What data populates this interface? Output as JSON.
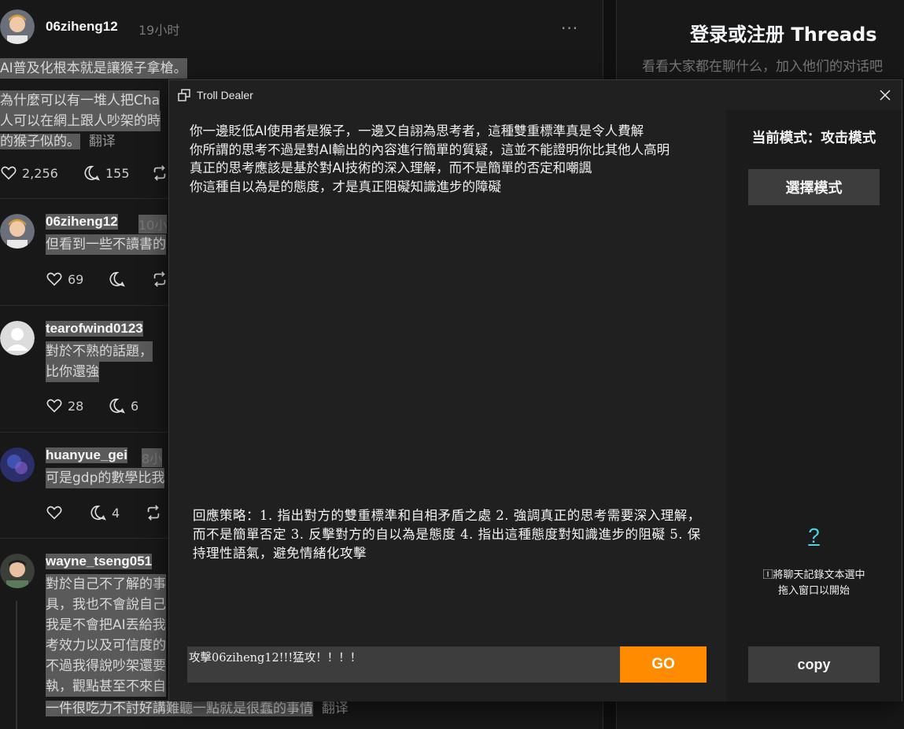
{
  "feed": {
    "posts": [
      {
        "user": "06ziheng12",
        "time": "19小时",
        "lines": [
          "AI普及化根本就是讓猴子拿槍。",
          "為什麼可以有一堆人把Cha",
          "人可以在網上跟人吵架的時",
          "的猴子似的。"
        ],
        "translate": "翻译",
        "likes": "2,256",
        "replies": "155"
      },
      {
        "user": "06ziheng12",
        "time": "10小",
        "lines": [
          "但看到一些不讀書的"
        ],
        "likes": "69"
      },
      {
        "user": "tearofwind0123",
        "lines": [
          "對於不熟的話題，",
          "比你還強"
        ],
        "likes": "28",
        "replies": "6"
      },
      {
        "user": "huanyue_gei",
        "time": "8小",
        "lines": [
          "可是gdp的數學比我"
        ],
        "replies": "4"
      },
      {
        "user": "wayne_tseng051",
        "lines": [
          "對於自己不了解的事",
          "具，我也不會說自己",
          "我是不會把AI丟給我",
          "考效力以及可信度的",
          "不過我得說吵架還要",
          "執，觀點甚至不來自",
          "一件很吃力不討好講難聽一點就是很蠢的事情"
        ],
        "translate": "翻译"
      }
    ]
  },
  "login": {
    "title": "登录或注册 Threads",
    "subtitle": "看看大家都在聊什么，加入他们的对话吧"
  },
  "app": {
    "title": "Troll Dealer",
    "reply_text": "你一邊貶低AI使用者是猴子，一邊又自詡為思考者，這種雙重標準真是令人費解\n你所謂的思考不過是對AI輸出的內容進行簡單的質疑，這並不能證明你比其他人高明\n真正的思考應該是基於對AI技術的深入理解，而不是簡單的否定和嘲諷\n你這種自以為是的態度，才是真正阻礙知識進步的障礙",
    "strategy_text": "回應策略：1. 指出對方的雙重標準和自相矛盾之處 2. 強調真正的思考需要深入理解，而不是簡單否定 3. 反擊對方的自以為是態度 4. 指出這種態度對知識進步的阻礙 5. 保持理性語氣，避免情緒化攻擊",
    "input_value": "攻擊06ziheng12!!!猛攻！！！！",
    "go_label": "GO",
    "mode_label": "当前模式：攻击模式",
    "select_mode_label": "選擇模式",
    "help_label": "?",
    "hint_line1": "🄸將聊天記錄文本選中",
    "hint_line2": "拖入窗口以開始",
    "copy_label": "copy"
  },
  "colors": {
    "accent": "#ff8c00",
    "link": "#4fd1e8",
    "panel": "#202020",
    "side": "#1b1b1b",
    "button": "#3d3d3d"
  },
  "icons": [
    "heart-icon",
    "comment-icon",
    "repost-icon",
    "more-icon",
    "window-icon",
    "close-icon"
  ]
}
